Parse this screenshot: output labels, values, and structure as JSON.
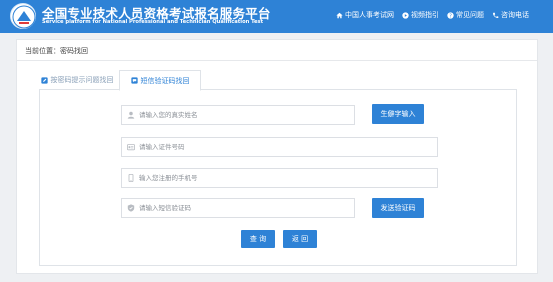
{
  "header": {
    "title_cn": "全国专业技术人员资格考试报名服务平台",
    "title_en": "Service platform for National Professional and Technician Qualification Test",
    "logo_icon": "emblem-icon",
    "nav": [
      {
        "label": "中国人事考试网",
        "icon": "home-icon"
      },
      {
        "label": "视频指引",
        "icon": "play-icon"
      },
      {
        "label": "常见问题",
        "icon": "question-icon"
      },
      {
        "label": "咨询电话",
        "icon": "phone-icon"
      }
    ]
  },
  "breadcrumb": {
    "text": "当前位置：密码找回"
  },
  "tabs": [
    {
      "label": "按密码提示问题找回",
      "icon": "edit-icon",
      "active": false
    },
    {
      "label": "短信验证码找回",
      "icon": "sms-icon",
      "active": true
    }
  ],
  "form": {
    "name": {
      "placeholder": "请输入您的真实姓名",
      "icon": "user-icon"
    },
    "rare_char_button": "生僻字输入",
    "id_number": {
      "placeholder": "请输入证件号码",
      "icon": "id-card-icon"
    },
    "phone": {
      "placeholder": "输入您注册的手机号",
      "icon": "mobile-icon"
    },
    "sms_code": {
      "placeholder": "请输入短信验证码",
      "icon": "shield-icon"
    },
    "send_code_button": "发送验证码",
    "query_button": "查 询",
    "back_button": "返 回"
  },
  "colors": {
    "brand": "#2e82d6",
    "background": "#eef0f3"
  }
}
